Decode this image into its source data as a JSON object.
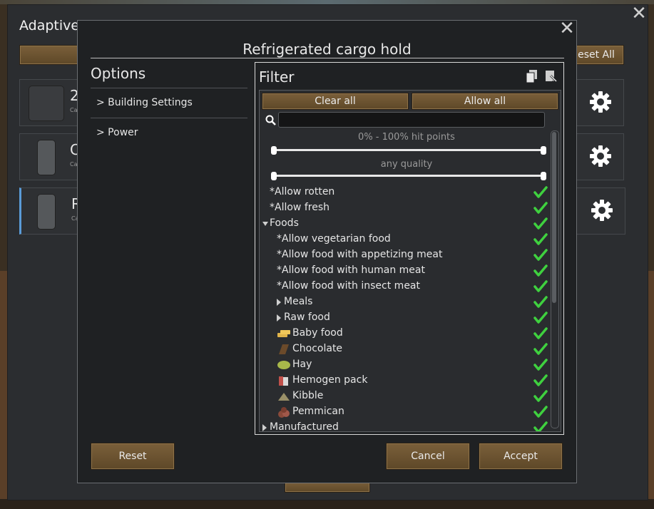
{
  "back_window": {
    "title": "Adaptive",
    "close_glyph": "✕",
    "reset_all_label": "eset All",
    "rows": [
      {
        "letter": "2",
        "sub": "Ca"
      },
      {
        "letter": "C",
        "sub": "Ca"
      },
      {
        "letter": "R",
        "sub": "Ca"
      }
    ]
  },
  "dialog": {
    "title": "Refrigerated cargo hold",
    "close_glyph": "✕",
    "options_title": "Options",
    "options": [
      "> Building Settings",
      "> Power"
    ],
    "buttons": {
      "reset": "Reset",
      "cancel": "Cancel",
      "accept": "Accept"
    }
  },
  "filter": {
    "title": "Filter",
    "clear_all": "Clear all",
    "allow_all": "Allow all",
    "search": {
      "value": "",
      "placeholder": ""
    },
    "hit_points_label": "0% - 100% hit points",
    "hit_points_range": [
      0,
      100
    ],
    "quality_label": "any quality",
    "items": [
      {
        "label": "*Allow rotten",
        "indent": 0,
        "kind": "option",
        "checked": true
      },
      {
        "label": "*Allow fresh",
        "indent": 0,
        "kind": "option",
        "checked": true
      },
      {
        "label": "Foods",
        "indent": 0,
        "kind": "expanded",
        "checked": true
      },
      {
        "label": "*Allow vegetarian food",
        "indent": 1,
        "kind": "option",
        "checked": true
      },
      {
        "label": "*Allow food with appetizing meat",
        "indent": 1,
        "kind": "option",
        "checked": true
      },
      {
        "label": "*Allow food with human meat",
        "indent": 1,
        "kind": "option",
        "checked": true
      },
      {
        "label": "*Allow food with insect meat",
        "indent": 1,
        "kind": "option",
        "checked": true
      },
      {
        "label": "Meals",
        "indent": 1,
        "kind": "collapsed",
        "checked": true
      },
      {
        "label": "Raw food",
        "indent": 1,
        "kind": "collapsed",
        "checked": true
      },
      {
        "label": "Baby food",
        "indent": 1,
        "kind": "thing",
        "icon": "baby-food-icon",
        "checked": true
      },
      {
        "label": "Chocolate",
        "indent": 1,
        "kind": "thing",
        "icon": "chocolate-icon",
        "checked": true
      },
      {
        "label": "Hay",
        "indent": 1,
        "kind": "thing",
        "icon": "hay-icon",
        "checked": true
      },
      {
        "label": "Hemogen pack",
        "indent": 1,
        "kind": "thing",
        "icon": "hemogen-pack-icon",
        "checked": true
      },
      {
        "label": "Kibble",
        "indent": 1,
        "kind": "thing",
        "icon": "kibble-icon",
        "checked": true
      },
      {
        "label": "Pemmican",
        "indent": 1,
        "kind": "thing",
        "icon": "pemmican-icon",
        "checked": true
      },
      {
        "label": "Manufactured",
        "indent": 0,
        "kind": "collapsed",
        "checked": true
      }
    ]
  },
  "colors": {
    "accent_check": "#3fd13f",
    "button_brown": "#6b5230",
    "selection_blue": "#5a9bd8"
  }
}
